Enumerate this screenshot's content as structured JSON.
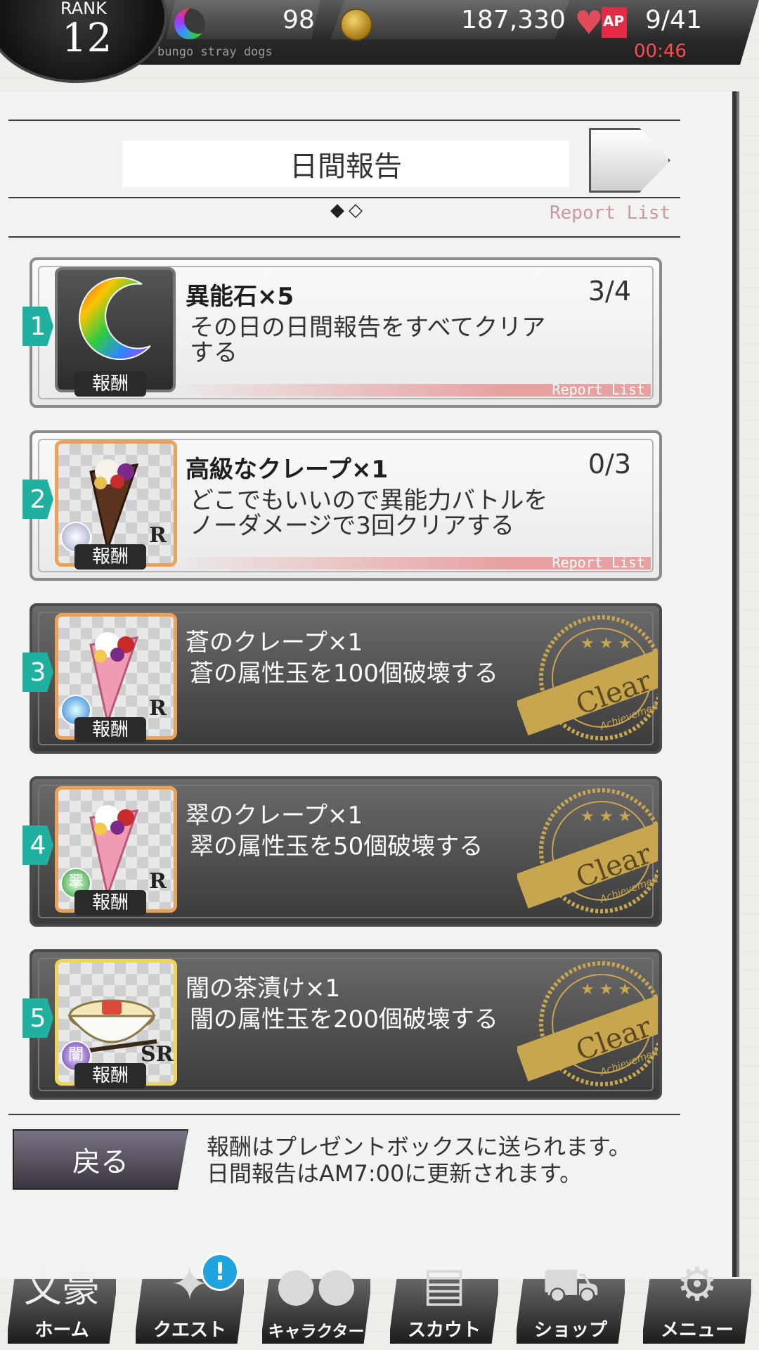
{
  "hud": {
    "rank_label": "RANK",
    "rank_value": "12",
    "game_title": "bungo stray dogs",
    "stones": "98",
    "coins": "187,330",
    "ap_label": "AP",
    "ap": "9/41",
    "ap_timer": "00:46"
  },
  "header": {
    "title": "日間報告",
    "page_dots": "◆◇",
    "report_list_link": "Report List"
  },
  "reports": [
    {
      "num": "1",
      "item": "異能石×5",
      "progress": "3/4",
      "desc": "その日の日間報告をすべてクリアする",
      "reward_tag": "報酬",
      "rarity": "",
      "status": "open",
      "footer": "Report List"
    },
    {
      "num": "2",
      "item": "高級なクレープ×1",
      "progress": "0/3",
      "desc": "どこでもいいので異能力バトルをノーダメージで3回クリアする",
      "reward_tag": "報酬",
      "rarity": "R",
      "status": "open",
      "footer": "Report List"
    },
    {
      "num": "3",
      "item": "蒼のクレープ×1",
      "progress": "",
      "desc": "蒼の属性玉を100個破壊する",
      "reward_tag": "報酬",
      "rarity": "R",
      "status": "done",
      "seal": "Clear",
      "seal_sub": "Achievement"
    },
    {
      "num": "4",
      "item": "翠のクレープ×1",
      "progress": "",
      "desc": "翠の属性玉を50個破壊する",
      "reward_tag": "報酬",
      "rarity": "R",
      "status": "done",
      "seal": "Clear",
      "seal_sub": "Achievement",
      "elem_glyph": "翠"
    },
    {
      "num": "5",
      "item": "闇の茶漬け×1",
      "progress": "",
      "desc": "闇の属性玉を200個破壊する",
      "reward_tag": "報酬",
      "rarity": "SR",
      "status": "done",
      "seal": "Clear",
      "seal_sub": "Achievement",
      "elem_glyph": "闇"
    }
  ],
  "footer": {
    "back_label": "戻る",
    "note_line1": "報酬はプレゼントボックスに送られます。",
    "note_line2": "日間報告はAM7:00に更新されます。"
  },
  "nav": {
    "home": "ホーム",
    "home_glyph": "文豪",
    "quest": "クエスト",
    "quest_alert": "!",
    "character": "キャラクター",
    "scout": "スカウト",
    "shop": "ショップ",
    "menu": "メニュー"
  },
  "colors": {
    "badge_teal": "#20b0a0",
    "timer_red": "#ff4b4b",
    "seal_gold": "#c8a650"
  }
}
